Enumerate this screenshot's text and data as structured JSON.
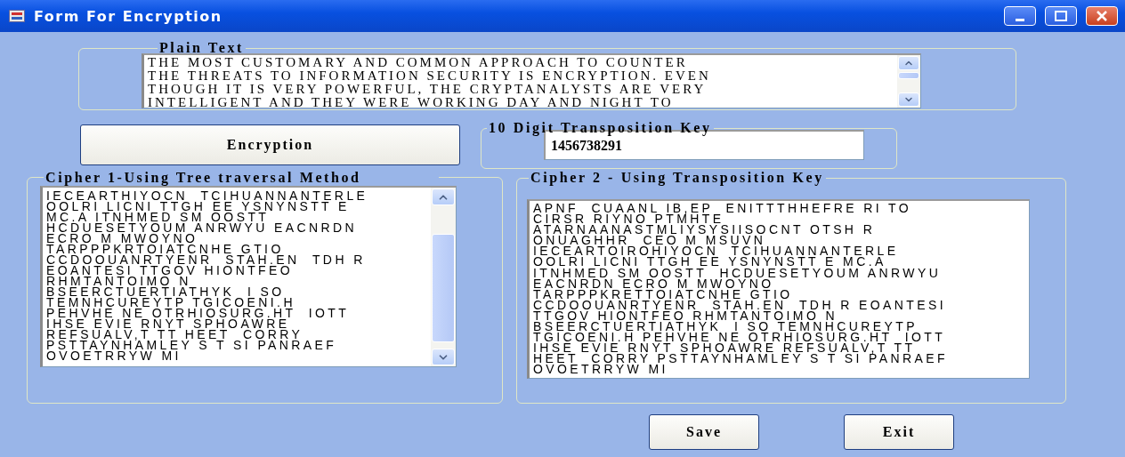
{
  "window": {
    "title": "Form For Encryption"
  },
  "plain_text": {
    "label": "Plain Text",
    "lines": [
      "THE MOST CUSTOMARY AND COMMON APPROACH TO COUNTER",
      "THE THREATS TO INFORMATION SECURITY IS ENCRYPTION. EVEN",
      "THOUGH IT IS VERY POWERFUL, THE CRYPTANALYSTS ARE VERY",
      "INTELLIGENT AND THEY WERE WORKING DAY AND NIGHT TO"
    ]
  },
  "encrypt_button": "Encryption",
  "key": {
    "label": "10 Digit Transposition Key",
    "value": "1456738291"
  },
  "cipher_1": {
    "label": "Cipher 1-Using Tree traversal Method",
    "lines": [
      "IECEARTHIYOCN  TCIHUANNANTERLE",
      "OOLRI LICNI TTGH EE YSNYNSTT E",
      "MC.A ITNHMED SM OOSTT",
      "HCDUESETYOUM ANRWYU EACNRDN",
      "ECRO M MWOYNO",
      "TARPPPKRTOIATCNHE GTIO",
      "CCDOOUANRTYENR  STAH.EN  TDH R",
      "EOANTESI TTGOV HIONTFEO",
      "RHMTANTOIMO N",
      "BSEERCTUERTIATHYK  I SO",
      "TEMNHCUREYTP TGICOENI.H",
      "PEHVHE NE OTRHIOSURG.HT  IOTT",
      "IHSE EVIE RNYT SPHOAWRE",
      "REFSUALV,T TT HEET  CORRY",
      "PSTTAYNHAMLEY S T SI PANRAEF",
      "OVOETRRYW MI"
    ]
  },
  "cipher_2": {
    "label": "Cipher 2 -  Using Transposition Key",
    "lines": [
      "APNF  CUAANL IB,EP  ENITTTHHEFRE RI TO",
      "CIRSR RIYNO PTMHTE",
      "ATARNAANASTMLIYSYSIISOCNT OTSH R",
      "ONUAGHHR  CEO M MSUVN",
      "IECEARTOIROHIYOCN  TCIHUANNANTERLE",
      "OOLRI LICNI TTGH EE YSNYNSTT E MC.A",
      "ITNHMED SM OOSTT  HCDUESETYOUM ANRWYU",
      "EACNRDN ECRO M MWOYNO",
      "TARPPPKRETTOIATCNHE GTIO",
      "CCDOOUANRTYENR  STAH.EN  TDH R EOANTESI",
      "TTGOV HIONTFEO RHMTANTOIMO N",
      "BSEERCTUERTIATHYK  I SO TEMNHCUREYTP",
      "TGICOENI.H PEHVHE NE OTRHIOSURG.HT  IOTT",
      "IHSE EVIE RNYT SPHOAWRE REFSUALV,T TT",
      "HEET  CORRY PSTTAYNHAMLEY S T SI PANRAEF",
      "OVOETRRYW MI"
    ]
  },
  "buttons": [
    "Save",
    "Exit"
  ]
}
